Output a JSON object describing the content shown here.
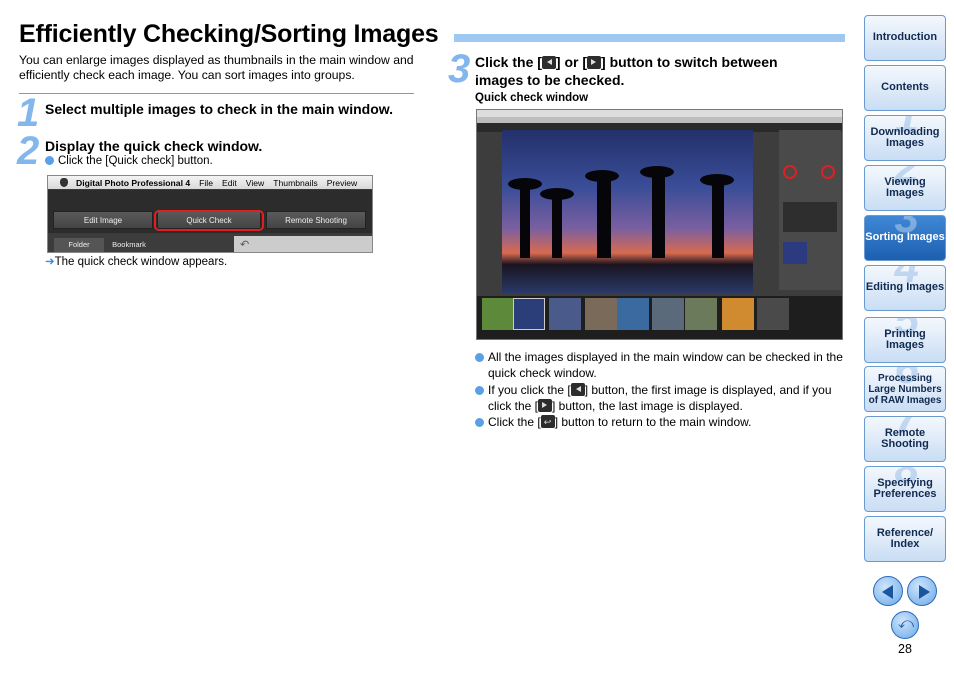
{
  "title": "Efficiently Checking/Sorting Images",
  "intro": "You can enlarge images displayed as thumbnails in the main window and efficiently check each image. You can sort images into groups.",
  "steps": [
    {
      "num": "1",
      "title": "Select multiple images to check in the main window."
    },
    {
      "num": "2",
      "title": "Display the quick check window.",
      "bullet": "Click the [Quick check] button.",
      "result": "The quick check window appears."
    },
    {
      "num": "3",
      "title_a": "Click the [",
      "title_b": "] or [",
      "title_c": "] button to switch between",
      "title_d": "images to be checked."
    }
  ],
  "dpp": {
    "menu": [
      "Digital Photo Professional 4",
      "File",
      "Edit",
      "View",
      "Thumbnails",
      "Preview"
    ],
    "tabs": [
      "Edit Image",
      "Quick Check",
      "Remote Shooting"
    ],
    "subtabs": [
      "Folder",
      "Bookmark"
    ]
  },
  "qc_label": "Quick check window",
  "notes": {
    "n1": "All the images displayed in the main window can be checked in the quick check window.",
    "n2a": "If you click the [",
    "n2b": "] button, the first image is displayed, and if you click the [",
    "n2c": "] button, the last image is displayed.",
    "n3a": "Click the [",
    "n3b": "] button to return to the main window."
  },
  "sidebar": [
    {
      "label": "Introduction",
      "num": ""
    },
    {
      "label": "Contents",
      "num": ""
    },
    {
      "label": "Downloading Images",
      "num": "1"
    },
    {
      "label": "Viewing Images",
      "num": "2"
    },
    {
      "label": "Sorting Images",
      "num": "3",
      "active": true
    },
    {
      "label": "Editing Images",
      "num": "4"
    },
    {
      "label": "Printing Images",
      "num": "5"
    },
    {
      "label": "Processing Large Numbers of RAW Images",
      "num": "6"
    },
    {
      "label": "Remote Shooting",
      "num": "7"
    },
    {
      "label": "Specifying Preferences",
      "num": "8"
    },
    {
      "label": "Reference/ Index",
      "num": ""
    }
  ],
  "page_number": "28"
}
